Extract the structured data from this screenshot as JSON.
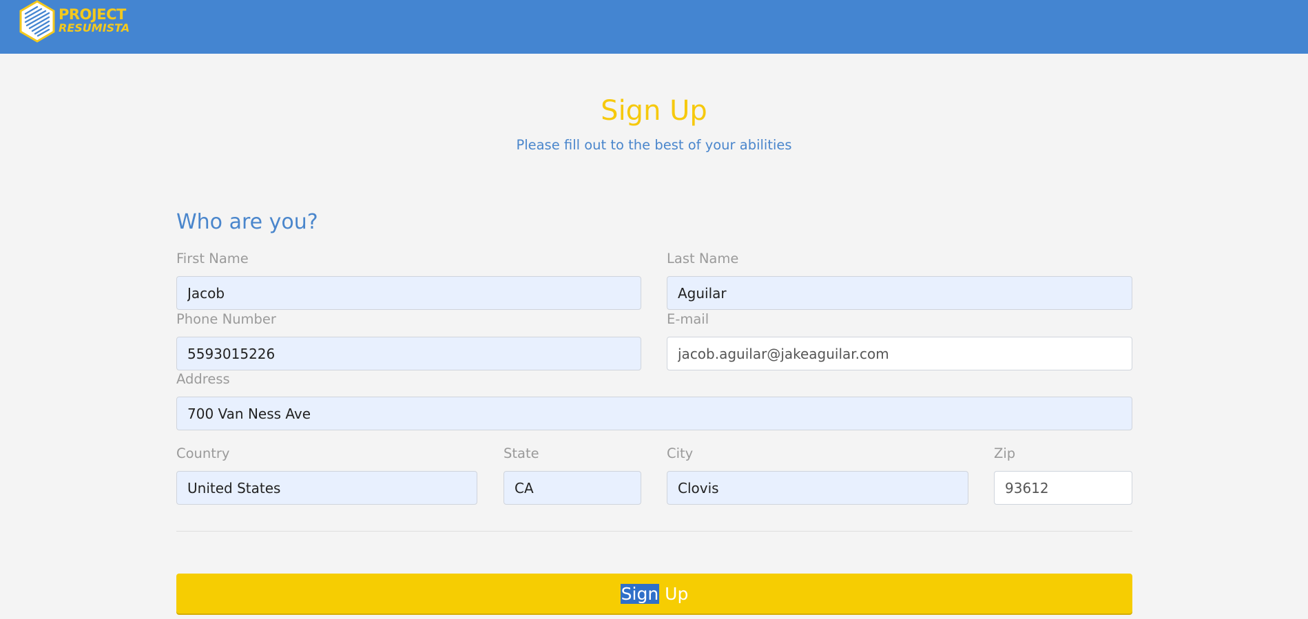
{
  "brand": {
    "line1": "PROJECT",
    "line2": "RESUMISTA",
    "icon": "cube-lines-logo-icon",
    "colors": {
      "header_bg": "#4485d1",
      "accent": "#f6c90d",
      "button": "#f6cd02"
    }
  },
  "page": {
    "title": "Sign Up",
    "subtitle": "Please fill out to the best of your abilities"
  },
  "form": {
    "section_title": "Who are you?",
    "first_name": {
      "label": "First Name",
      "value": "Jacob"
    },
    "last_name": {
      "label": "Last Name",
      "value": "Aguilar"
    },
    "phone": {
      "label": "Phone Number",
      "value": "5593015226"
    },
    "email": {
      "label": "E-mail",
      "value": "jacob.aguilar@jakeaguilar.com"
    },
    "address": {
      "label": "Address",
      "value": "700 Van Ness Ave"
    },
    "country": {
      "label": "Country",
      "value": "United States"
    },
    "state": {
      "label": "State",
      "value": "CA"
    },
    "city": {
      "label": "City",
      "value": "Clovis"
    },
    "zip": {
      "label": "Zip",
      "value": "93612"
    }
  },
  "submit": {
    "label_selected": "Sign",
    "label_rest": " Up"
  }
}
